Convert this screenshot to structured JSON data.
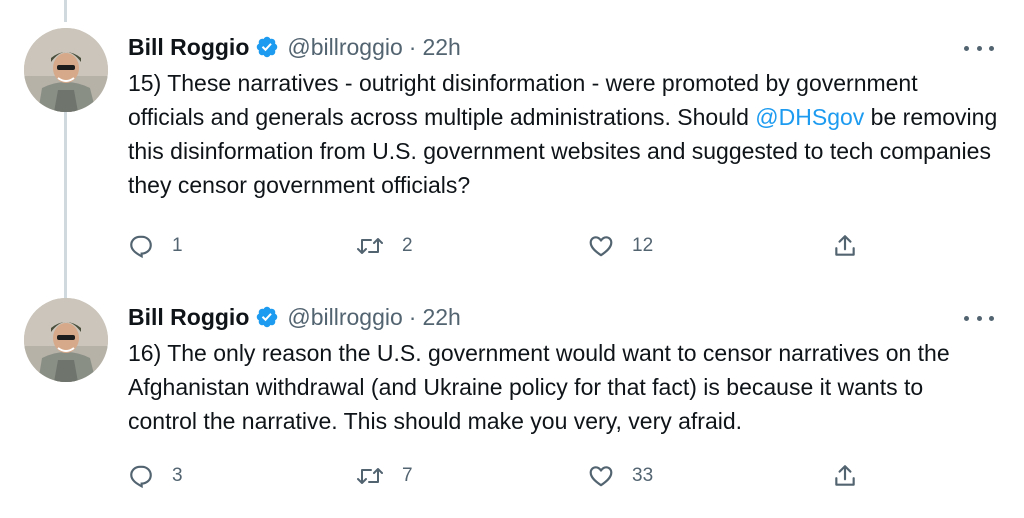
{
  "tweets": [
    {
      "author_name": "Bill Roggio",
      "handle": "@billroggio",
      "separator": "·",
      "time": "22h",
      "text_before": "15) These narratives - outright disinformation - were promoted by government officials and generals across multiple administrations. Should ",
      "mention": "@DHSgov",
      "text_after": " be removing this disinformation from U.S. government websites and suggested to tech companies they censor government officials?",
      "replies": "1",
      "retweets": "2",
      "likes": "12"
    },
    {
      "author_name": "Bill Roggio",
      "handle": "@billroggio",
      "separator": "·",
      "time": "22h",
      "text": "16) The only reason the U.S. government would want to censor narratives on the Afghanistan withdrawal (and Ukraine policy for that fact) is because it wants to control the narrative. This should make you very, very afraid.",
      "replies": "3",
      "retweets": "7",
      "likes": "33"
    }
  ],
  "icons": {
    "verified": "verified-badge-icon",
    "more": "more-options-icon",
    "reply": "reply-icon",
    "retweet": "retweet-icon",
    "like": "like-icon",
    "share": "share-icon"
  },
  "colors": {
    "accent": "#1d9bf0",
    "text": "#0f1419",
    "secondary": "#536471",
    "thread_line": "#cfd9de"
  }
}
